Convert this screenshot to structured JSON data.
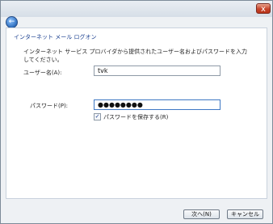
{
  "window": {
    "close_glyph": "x"
  },
  "header": {
    "back_glyph": "←",
    "title": "インターネット メール ログオン"
  },
  "content": {
    "instructions": "インターネット サービス プロバイダから提供されたユーザー名およびパスワードを入力してください。",
    "username_label": "ユーザー名(A):",
    "username_value": "tvk",
    "password_label": "パスワード(P):",
    "password_value": "●●●●●●●●",
    "remember_label": "パスワードを保存する(R)",
    "remember_checked": true,
    "check_glyph": "✓"
  },
  "footer": {
    "next_label": "次へ(N)",
    "cancel_label": "キャンセル"
  },
  "icons": [
    "close-icon",
    "back-arrow-icon",
    "checkmark-icon"
  ]
}
